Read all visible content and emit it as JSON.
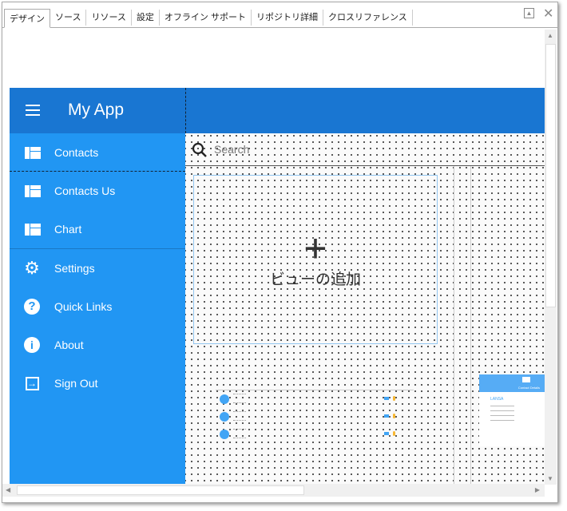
{
  "tabs": [
    "デザイン",
    "ソース",
    "リソース",
    "設定",
    "オフライン サポート",
    "リポジトリ詳細",
    "クロスリファレンス"
  ],
  "app": {
    "title": "My App",
    "nav": [
      {
        "label": "Contacts",
        "icon": "view-quilt-icon"
      },
      {
        "label": "Contacts Us",
        "icon": "view-quilt-icon"
      },
      {
        "label": "Chart",
        "icon": "view-quilt-icon"
      },
      {
        "label": "Settings",
        "icon": "gear-icon"
      },
      {
        "label": "Quick Links",
        "icon": "help-icon"
      },
      {
        "label": "About",
        "icon": "info-icon"
      },
      {
        "label": "Sign Out",
        "icon": "sign-out-icon"
      }
    ],
    "search_placeholder": "Search",
    "add_view": "ビューの追加",
    "card": {
      "title": "Contact Details",
      "name": "LANSA"
    }
  },
  "colors": {
    "header": "#1976d2",
    "sidebar": "#2196f3"
  }
}
